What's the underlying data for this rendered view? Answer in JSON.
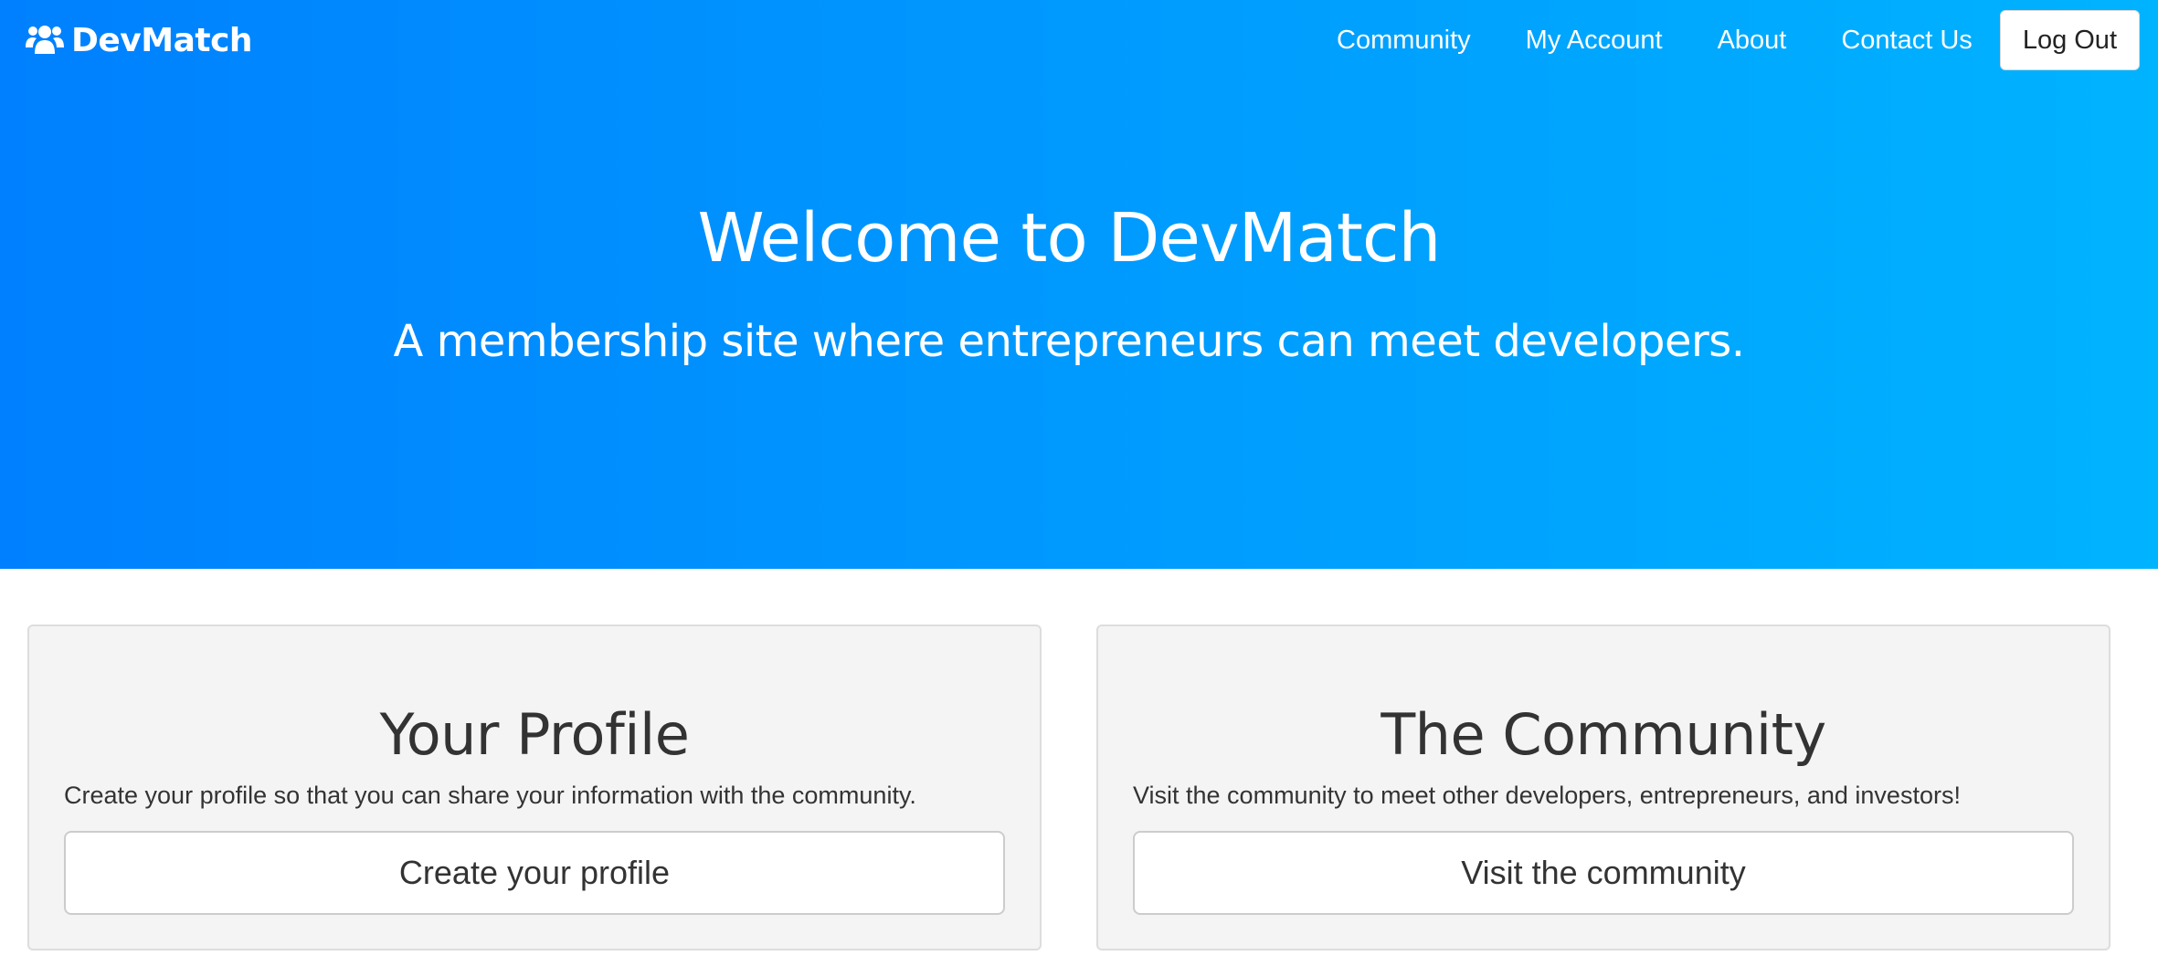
{
  "navbar": {
    "brand_icon": "users-icon",
    "brand_name": "DevMatch",
    "links": [
      {
        "label": "Community"
      },
      {
        "label": "My Account"
      },
      {
        "label": "About"
      },
      {
        "label": "Contact Us"
      }
    ],
    "logout_label": "Log Out"
  },
  "hero": {
    "title": "Welcome to DevMatch",
    "subtitle": "A membership site where entrepreneurs can meet developers.",
    "gradient_start": "#0080fe",
    "gradient_end": "#00b3ff"
  },
  "cards": [
    {
      "title": "Your Profile",
      "text": "Create your profile so that you can share your information with the community.",
      "button_label": "Create your profile"
    },
    {
      "title": "The Community",
      "text": "Visit the community to meet other developers, entrepreneurs, and investors!",
      "button_label": "Visit the community"
    }
  ]
}
